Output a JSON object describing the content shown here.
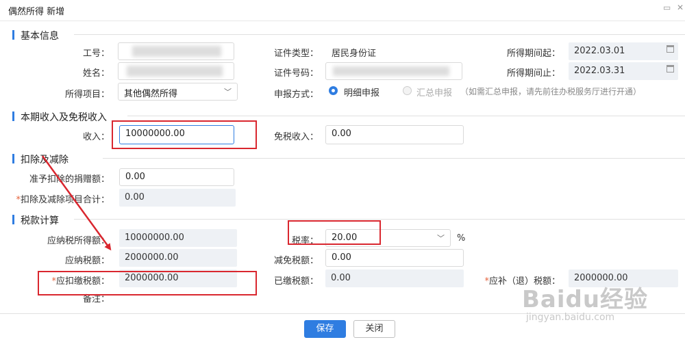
{
  "dialog": {
    "title": "偶然所得 新增"
  },
  "sections": {
    "basic": "基本信息",
    "income": "本期收入及免税收入",
    "deduction": "扣除及减除",
    "tax": "税款计算"
  },
  "basic": {
    "employee_id_label": "工号：",
    "name_label": "姓名：",
    "income_item_label": "所得项目：",
    "income_item_value": "其他偶然所得",
    "id_type_label": "证件类型：",
    "id_type_value": "居民身份证",
    "id_number_label": "证件号码：",
    "period_start_label": "所得期间起：",
    "period_start_value": "2022.03.01",
    "period_end_label": "所得期间止：",
    "period_end_value": "2022.03.31",
    "declare_label": "申报方式：",
    "declare_option1": "明细申报",
    "declare_option2": "汇总申报",
    "declare_note": "（如需汇总申报，请先前往办税服务厅进行开通）"
  },
  "income": {
    "income_label": "收入：",
    "income_value": "10000000.00",
    "exempt_label": "免税收入：",
    "exempt_value": "0.00"
  },
  "deduction": {
    "donation_label": "准予扣除的捐赠额：",
    "donation_value": "0.00",
    "total_label": "扣除及减除项目合计：",
    "total_value": "0.00"
  },
  "tax": {
    "taxable_label": "应纳税所得额：",
    "taxable_value": "10000000.00",
    "rate_label": "税率：",
    "rate_value": "20.00",
    "rate_unit": "%",
    "payable_label": "应纳税额：",
    "payable_value": "2000000.00",
    "reduction_label": "减免税额：",
    "reduction_value": "0.00",
    "withhold_label": "应扣缴税额：",
    "withhold_value": "2000000.00",
    "paid_label": "已缴税额：",
    "paid_value": "0.00",
    "refund_label": "应补（退）税额：",
    "refund_value": "2000000.00",
    "remark_label": "备注："
  },
  "buttons": {
    "save": "保存",
    "close": "关闭"
  },
  "watermark": {
    "logo": "Baidu经验",
    "url": "jingyan.baidu.com"
  },
  "colors": {
    "accent": "#2f7de1",
    "annotation": "#d9262e",
    "required": "#e5623c"
  }
}
